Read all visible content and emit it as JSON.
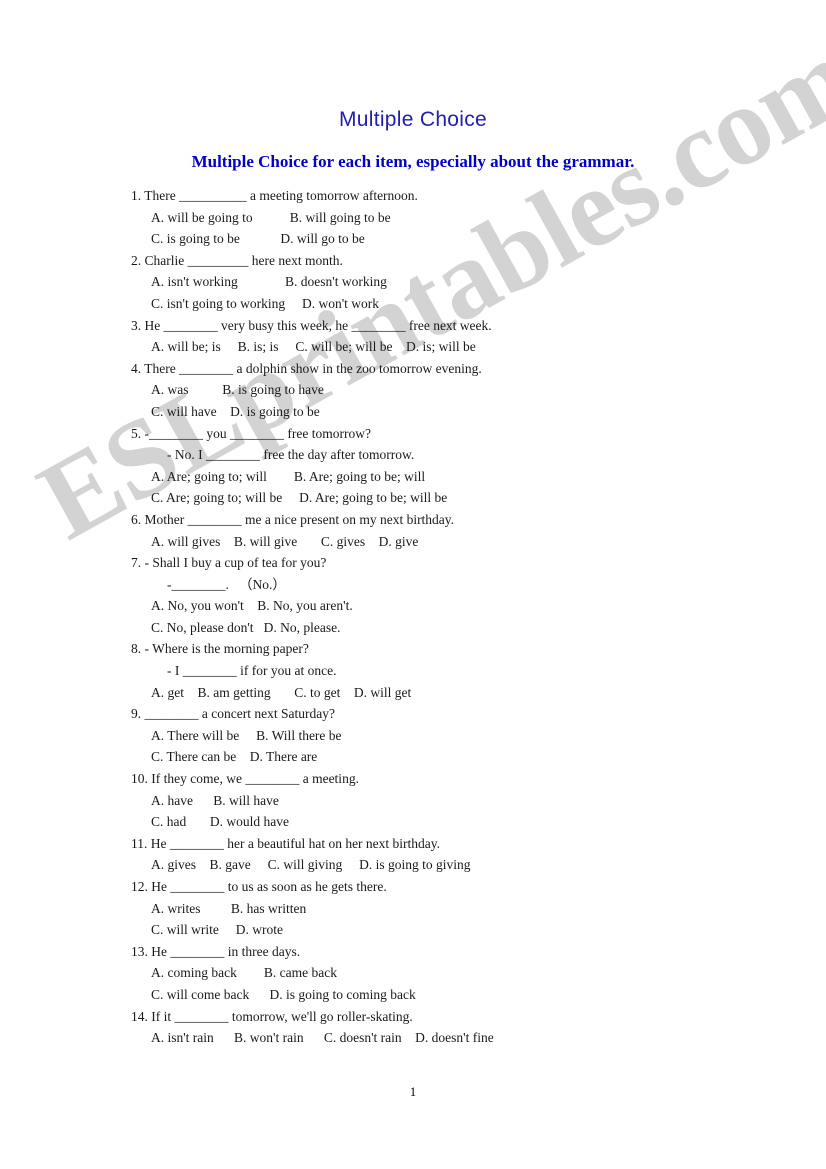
{
  "document": {
    "title": "Multiple Choice",
    "subtitle": "Multiple Choice for each item, especially about the grammar.",
    "page_number": "1",
    "watermark": "ESLprintables.com",
    "lines": [
      {
        "indent": 1,
        "text": "1. There __________ a meeting tomorrow afternoon."
      },
      {
        "indent": 2,
        "text": "A. will be going to           B. will going to be"
      },
      {
        "indent": 2,
        "text": "C. is going to be            D. will go to be"
      },
      {
        "indent": 1,
        "text": "2. Charlie _________ here next month."
      },
      {
        "indent": 2,
        "text": "A. isn't working              B. doesn't working"
      },
      {
        "indent": 2,
        "text": "C. isn't going to working     D. won't work"
      },
      {
        "indent": 1,
        "text": "3. He ________ very busy this week, he ________ free next week."
      },
      {
        "indent": 2,
        "text": "A. will be; is     B. is; is     C. will be; will be    D. is; will be"
      },
      {
        "indent": 1,
        "text": "4. There ________ a dolphin show in the zoo tomorrow evening."
      },
      {
        "indent": 2,
        "text": "A. was          B. is going to have"
      },
      {
        "indent": 2,
        "text": "C. will have    D. is going to be"
      },
      {
        "indent": 1,
        "text": "5. -________ you ________ free tomorrow?"
      },
      {
        "indent": 3,
        "text": "- No. I ________ free the day after tomorrow."
      },
      {
        "indent": 2,
        "text": "A. Are; going to; will        B. Are; going to be; will"
      },
      {
        "indent": 2,
        "text": "C. Are; going to; will be     D. Are; going to be; will be"
      },
      {
        "indent": 1,
        "text": "6. Mother ________ me a nice present on my next birthday."
      },
      {
        "indent": 2,
        "text": "A. will gives    B. will give       C. gives    D. give"
      },
      {
        "indent": 1,
        "text": "7. - Shall I buy a cup of tea for you?"
      },
      {
        "indent": 3,
        "text": "-________.   （No.）"
      },
      {
        "indent": 2,
        "text": "A. No, you won't    B. No, you aren't."
      },
      {
        "indent": 2,
        "text": "C. No, please don't   D. No, please."
      },
      {
        "indent": 1,
        "text": "8. - Where is the morning paper?"
      },
      {
        "indent": 3,
        "text": "- I ________ if for you at once."
      },
      {
        "indent": 2,
        "text": "A. get    B. am getting       C. to get    D. will get"
      },
      {
        "indent": 1,
        "text": "9. ________ a concert next Saturday?"
      },
      {
        "indent": 2,
        "text": "A. There will be     B. Will there be"
      },
      {
        "indent": 2,
        "text": "C. There can be    D. There are"
      },
      {
        "indent": 1,
        "text": "10. If they come, we ________ a meeting."
      },
      {
        "indent": 2,
        "text": "A. have      B. will have"
      },
      {
        "indent": 2,
        "text": "C. had       D. would have"
      },
      {
        "indent": 1,
        "text": "11. He ________ her a beautiful hat on her next birthday."
      },
      {
        "indent": 2,
        "text": "A. gives    B. gave     C. will giving     D. is going to giving"
      },
      {
        "indent": 1,
        "text": "12. He ________ to us as soon as he gets there."
      },
      {
        "indent": 2,
        "text": "A. writes         B. has written"
      },
      {
        "indent": 2,
        "text": "C. will write     D. wrote"
      },
      {
        "indent": 1,
        "text": "13. He ________ in three days."
      },
      {
        "indent": 2,
        "text": "A. coming back        B. came back"
      },
      {
        "indent": 2,
        "text": "C. will come back      D. is going to coming back"
      },
      {
        "indent": 1,
        "text": "14. If it ________ tomorrow, we'll go roller-skating."
      },
      {
        "indent": 2,
        "text": "A. isn't rain      B. won't rain      C. doesn't rain    D. doesn't fine"
      }
    ]
  }
}
